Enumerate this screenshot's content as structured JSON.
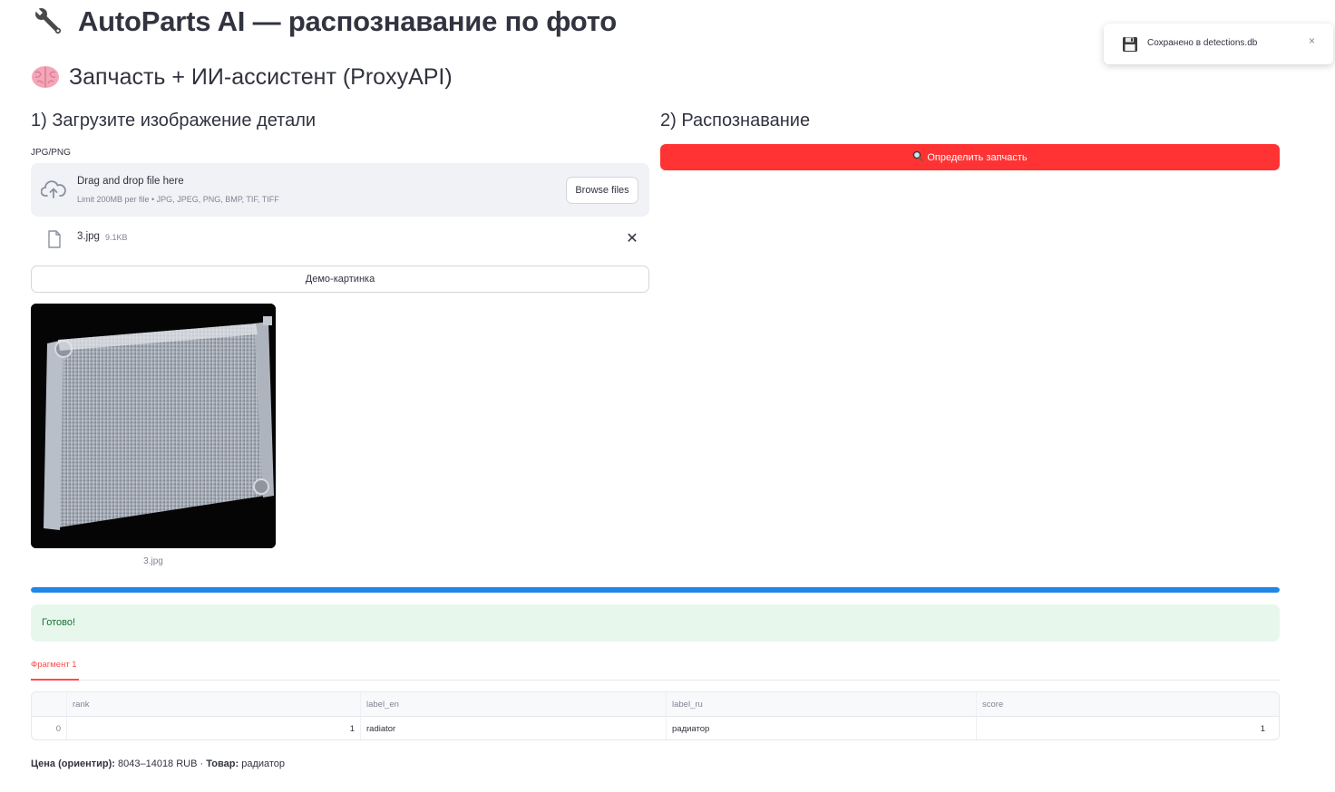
{
  "header": {
    "title": "AutoParts AI — распознавание по фото",
    "title_icon": "wrench-icon",
    "subtitle": "Запчасть + ИИ-ассистент (ProxyAPI)",
    "subtitle_icon": "brain-icon"
  },
  "left_column": {
    "heading": "1) Загрузите изображение детали",
    "uploader": {
      "label": "JPG/PNG",
      "drop_text": "Drag and drop file here",
      "limit_text": "Limit 200MB per file • JPG, JPEG, PNG, BMP, TIF, TIFF",
      "browse_label": "Browse files"
    },
    "uploaded_file": {
      "name": "3.jpg",
      "size": "9.1KB"
    },
    "demo_button_label": "Демо-картинка",
    "image_caption": "3.jpg"
  },
  "right_column": {
    "heading": "2) Распознавание",
    "detect_button_label": "Определить запчасть",
    "detect_button_icon": "magnifier-icon",
    "detect_button_color": "#ff3333"
  },
  "progress": {
    "value": 1.0,
    "color": "#1f87e5"
  },
  "status": {
    "text": "Готово!",
    "color": "#177233",
    "background": "#e8f7ec"
  },
  "tabs": [
    {
      "label": "Фрагмент 1",
      "active": true
    }
  ],
  "results_table": {
    "columns": [
      "rank",
      "label_en",
      "label_ru",
      "score"
    ],
    "rows": [
      {
        "index": "0",
        "rank": "1",
        "label_en": "radiator",
        "label_ru": "радиатор",
        "score": "1"
      }
    ]
  },
  "price_line": {
    "price_label": "Цена (ориентир):",
    "price_value": "8043–14018 RUB",
    "separator": "·",
    "product_label": "Товар:",
    "product_value": "радиатор"
  },
  "toast": {
    "text": "Сохранено в detections.db",
    "icon": "floppy-disk-icon",
    "close": "×"
  }
}
